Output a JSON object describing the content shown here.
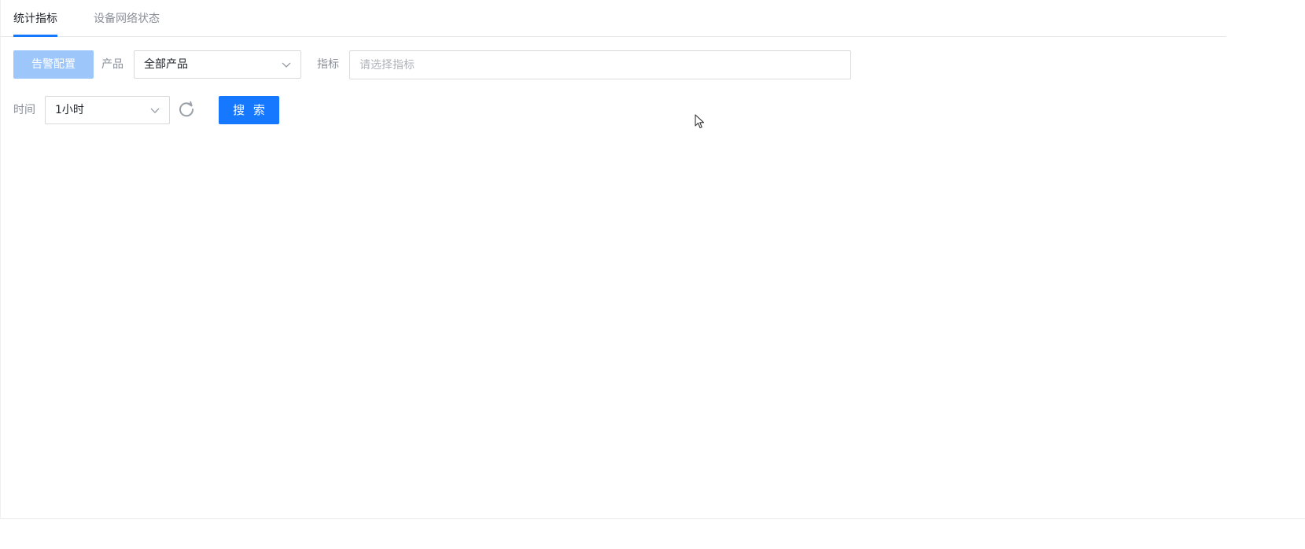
{
  "tabs": [
    {
      "label": "统计指标",
      "active": true
    },
    {
      "label": "设备网络状态",
      "active": false
    }
  ],
  "filters": {
    "alarm_config_label": "告警配置",
    "product_label": "产品",
    "product_value": "全部产品",
    "metric_label": "指标",
    "metric_placeholder": "请选择指标",
    "time_label": "时间",
    "time_value": "1小时",
    "refresh_icon": "refresh-icon",
    "search_label": "搜 索"
  },
  "colors": {
    "primary": "#1677ff",
    "primary_disabled": "#9dc6fa",
    "label_gray": "#8a8f99",
    "border": "#d9d9d9"
  }
}
